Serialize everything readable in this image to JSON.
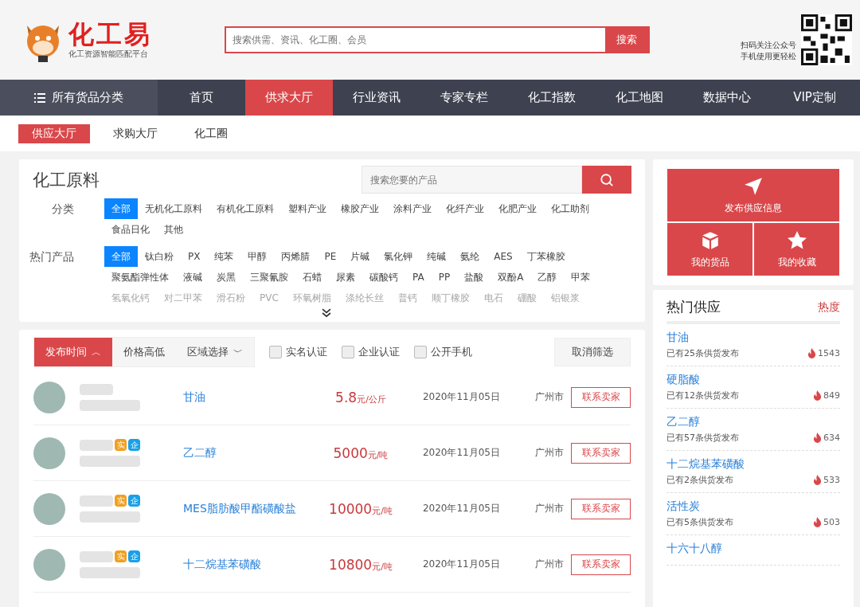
{
  "header": {
    "logo_text": "化工易",
    "logo_subtitle": "化工资源智能匹配平台",
    "search": {
      "placeholder": "搜索供需、资讯、化工圈、会员",
      "button": "搜索"
    },
    "qr_caption": [
      "扫码关注公众号",
      "手机使用更轻松"
    ]
  },
  "nav": {
    "all_categories": "所有货品分类",
    "items": [
      {
        "label": "首页",
        "selected": false
      },
      {
        "label": "供求大厅",
        "selected": true
      },
      {
        "label": "行业资讯",
        "selected": false
      },
      {
        "label": "专家专栏",
        "selected": false
      },
      {
        "label": "化工指数",
        "selected": false
      },
      {
        "label": "化工地图",
        "selected": false
      },
      {
        "label": "数据中心",
        "selected": false
      },
      {
        "label": "VIP定制",
        "selected": false
      }
    ]
  },
  "subnav": [
    {
      "label": "供应大厅",
      "selected": true
    },
    {
      "label": "求购大厅",
      "selected": false
    },
    {
      "label": "化工圈",
      "selected": false
    }
  ],
  "materials": {
    "title": "化工原料",
    "search": {
      "placeholder": "搜索您要的产品"
    },
    "filters": [
      {
        "label": "分类",
        "options": [
          {
            "label": "全部",
            "selected": true
          },
          {
            "label": "无机化工原料",
            "selected": false
          },
          {
            "label": "有机化工原料",
            "selected": false
          },
          {
            "label": "塑料产业",
            "selected": false
          },
          {
            "label": "橡胶产业",
            "selected": false
          },
          {
            "label": "涂料产业",
            "selected": false
          },
          {
            "label": "化纤产业",
            "selected": false
          },
          {
            "label": "化肥产业",
            "selected": false
          },
          {
            "label": "化工助剂",
            "selected": false
          },
          {
            "label": "食品日化",
            "selected": false
          },
          {
            "label": "其他",
            "selected": false
          }
        ]
      },
      {
        "label": "热门产品",
        "options": [
          {
            "label": "全部",
            "selected": true
          },
          {
            "label": "钛白粉",
            "selected": false
          },
          {
            "label": "PX",
            "selected": false
          },
          {
            "label": "纯苯",
            "selected": false
          },
          {
            "label": "甲醇",
            "selected": false
          },
          {
            "label": "丙烯腈",
            "selected": false
          },
          {
            "label": "PE",
            "selected": false
          },
          {
            "label": "片碱",
            "selected": false
          },
          {
            "label": "氯化钾",
            "selected": false
          },
          {
            "label": "纯碱",
            "selected": false
          },
          {
            "label": "氨纶",
            "selected": false
          },
          {
            "label": "AES",
            "selected": false
          },
          {
            "label": "丁苯橡胶",
            "selected": false
          },
          {
            "label": "聚氨酯弹性体",
            "selected": false
          },
          {
            "label": "液碱",
            "selected": false
          },
          {
            "label": "炭黑",
            "selected": false
          },
          {
            "label": "三聚氰胺",
            "selected": false
          },
          {
            "label": "石蜡",
            "selected": false
          },
          {
            "label": "尿素",
            "selected": false
          },
          {
            "label": "碳酸钙",
            "selected": false
          },
          {
            "label": "PA",
            "selected": false
          },
          {
            "label": "PP",
            "selected": false
          },
          {
            "label": "盐酸",
            "selected": false
          },
          {
            "label": "双酚A",
            "selected": false
          },
          {
            "label": "乙醇",
            "selected": false
          },
          {
            "label": "甲苯",
            "selected": false
          }
        ],
        "faded_options": [
          "氢氧化钙",
          "对二甲苯",
          "滑石粉",
          "PVC",
          "环氧树脂",
          "涤纶长丝",
          "普钙",
          "顺丁橡胶",
          "电石",
          "硼酸",
          "铝银浆"
        ]
      }
    ]
  },
  "listing": {
    "sorts": [
      {
        "label": "发布时间",
        "selected": true,
        "caret": "︿"
      },
      {
        "label": "价格高低",
        "selected": false
      },
      {
        "label": "区域选择",
        "selected": false,
        "caret": "﹀"
      }
    ],
    "checks": [
      {
        "label": "实名认证",
        "checked": false
      },
      {
        "label": "企业认证",
        "checked": false
      },
      {
        "label": "公开手机",
        "checked": false
      }
    ],
    "reset": "取消筛选",
    "rows": [
      {
        "badges": [],
        "product": "甘油",
        "price": "5.8",
        "unit": "元/公斤",
        "date": "2020年11月05日",
        "city": "广州市",
        "action": "联系卖家"
      },
      {
        "badges": [
          {
            "kind": "real",
            "text": "实"
          },
          {
            "kind": "company",
            "text": "企"
          }
        ],
        "product": "乙二醇",
        "price": "5000",
        "unit": "元/吨",
        "date": "2020年11月05日",
        "city": "广州市",
        "action": "联系卖家"
      },
      {
        "badges": [
          {
            "kind": "real",
            "text": "实"
          },
          {
            "kind": "company",
            "text": "企"
          }
        ],
        "product": "MES脂肪酸甲酯磺酸盐",
        "price": "10000",
        "unit": "元/吨",
        "date": "2020年11月05日",
        "city": "广州市",
        "action": "联系卖家"
      },
      {
        "badges": [
          {
            "kind": "real",
            "text": "实"
          },
          {
            "kind": "company",
            "text": "企"
          }
        ],
        "product": "十二烷基苯磺酸",
        "price": "10800",
        "unit": "元/吨",
        "date": "2020年11月05日",
        "city": "广州市",
        "action": "联系卖家"
      }
    ]
  },
  "actions": [
    {
      "kind": "send",
      "label": "发布供应信息"
    },
    {
      "kind": "box",
      "label": "我的货品"
    },
    {
      "kind": "star",
      "label": "我的收藏"
    }
  ],
  "hot": {
    "title": "热门供应",
    "sort_label": "热度",
    "items": [
      {
        "name": "甘油",
        "count": "已有25条供货发布",
        "heat": "1543"
      },
      {
        "name": "硬脂酸",
        "count": "已有12条供货发布",
        "heat": "849"
      },
      {
        "name": "乙二醇",
        "count": "已有57条供货发布",
        "heat": "634"
      },
      {
        "name": "十二烷基苯磺酸",
        "count": "已有2条供货发布",
        "heat": "533"
      },
      {
        "name": "活性炭",
        "count": "已有5条供货发布",
        "heat": "503"
      },
      {
        "name": "十六十八醇"
      }
    ]
  }
}
